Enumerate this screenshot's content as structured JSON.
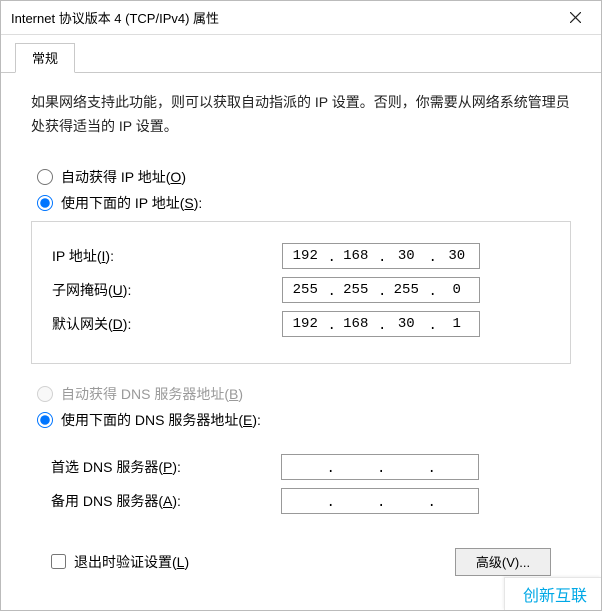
{
  "window": {
    "title": "Internet 协议版本 4 (TCP/IPv4) 属性"
  },
  "tab": {
    "general": "常规"
  },
  "description": "如果网络支持此功能，则可以获取自动指派的 IP 设置。否则，你需要从网络系统管理员处获得适当的 IP 设置。",
  "ip": {
    "auto_label_pre": "自动获得 IP 地址(",
    "auto_key": "O",
    "auto_label_post": ")",
    "manual_label_pre": "使用下面的 IP 地址(",
    "manual_key": "S",
    "manual_label_post": "):",
    "fields": {
      "address_label_pre": "IP 地址(",
      "address_key": "I",
      "address_label_post": "):",
      "address": {
        "o1": "192",
        "o2": "168",
        "o3": "30",
        "o4": "30"
      },
      "mask_label_pre": "子网掩码(",
      "mask_key": "U",
      "mask_label_post": "):",
      "mask": {
        "o1": "255",
        "o2": "255",
        "o3": "255",
        "o4": "0"
      },
      "gw_label_pre": "默认网关(",
      "gw_key": "D",
      "gw_label_post": "):",
      "gw": {
        "o1": "192",
        "o2": "168",
        "o3": "30",
        "o4": "1"
      }
    }
  },
  "dns": {
    "auto_label_pre": "自动获得 DNS 服务器地址(",
    "auto_key": "B",
    "auto_label_post": ")",
    "manual_label_pre": "使用下面的 DNS 服务器地址(",
    "manual_key": "E",
    "manual_label_post": "):",
    "fields": {
      "pref_label_pre": "首选 DNS 服务器(",
      "pref_key": "P",
      "pref_label_post": "):",
      "pref": {
        "o1": "",
        "o2": "",
        "o3": "",
        "o4": ""
      },
      "alt_label_pre": "备用 DNS 服务器(",
      "alt_key": "A",
      "alt_label_post": "):",
      "alt": {
        "o1": "",
        "o2": "",
        "o3": "",
        "o4": ""
      }
    }
  },
  "validate": {
    "pre": "退出时验证设置(",
    "key": "L",
    "post": ")"
  },
  "advanced_button": "高级(V)...",
  "watermark": "创新互联"
}
